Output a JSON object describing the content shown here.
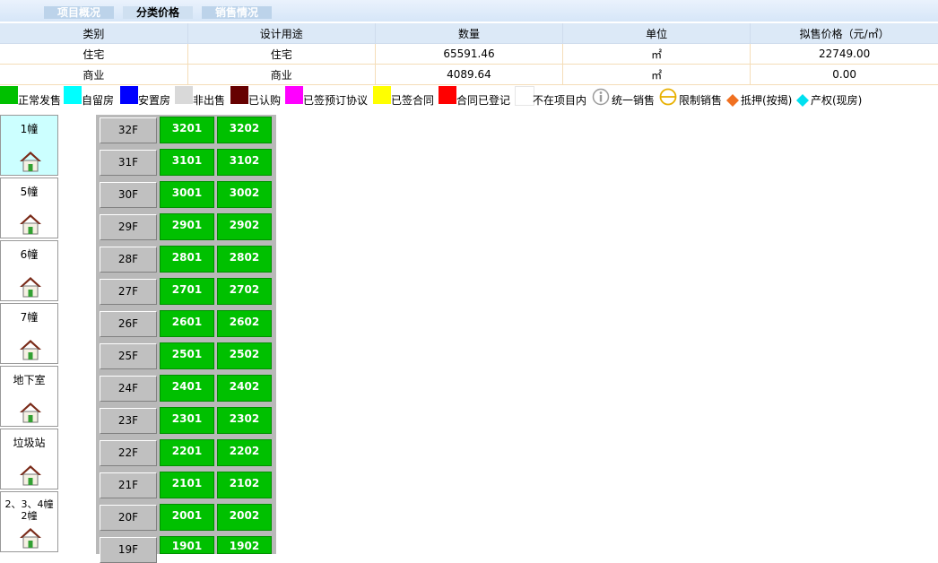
{
  "tabs": [
    "项目概况",
    "分类价格",
    "销售情况"
  ],
  "summary": {
    "headers": [
      "类别",
      "设计用途",
      "数量",
      "单位",
      "拟售价格（元/㎡）"
    ],
    "rows": [
      [
        "住宅",
        "住宅",
        "65591.46",
        "㎡",
        "22749.00"
      ],
      [
        "商业",
        "商业",
        "4089.64",
        "㎡",
        "0.00"
      ]
    ]
  },
  "legend": {
    "items": [
      {
        "label": "正常发售",
        "color": "#00c000"
      },
      {
        "label": "自留房",
        "color": "#00ffff"
      },
      {
        "label": "安置房",
        "color": "#0000ff"
      },
      {
        "label": "非出售",
        "color": "#d9d9d9"
      },
      {
        "label": "已认购",
        "color": "#660000"
      },
      {
        "label": "已签预订协议",
        "color": "#ff00ff"
      },
      {
        "label": "已签合同",
        "color": "#ffff00"
      },
      {
        "label": "合同已登记",
        "color": "#ff0000"
      },
      {
        "label": "不在项目内",
        "color": "#ffffff"
      }
    ],
    "symbols": [
      {
        "label": "统一销售",
        "icon": "info-circle-icon"
      },
      {
        "label": "限制销售",
        "icon": "limit-circle-icon"
      },
      {
        "label": "抵押(按揭)",
        "icon": "orange-diamond-icon",
        "color": "#f07020"
      },
      {
        "label": "产权(现房)",
        "icon": "cyan-diamond-icon",
        "color": "#00e0f0"
      }
    ]
  },
  "buildings": [
    {
      "name": "1幢",
      "active": true
    },
    {
      "name": "5幢",
      "active": false
    },
    {
      "name": "6幢",
      "active": false
    },
    {
      "name": "7幢",
      "active": false
    },
    {
      "name": "地下室",
      "active": false
    },
    {
      "name": "垃圾站",
      "active": false
    },
    {
      "name": "2、3、4幢2幢",
      "active": false
    }
  ],
  "floors": [
    {
      "floor": "32F",
      "rooms": [
        "3201",
        "3202"
      ]
    },
    {
      "floor": "31F",
      "rooms": [
        "3101",
        "3102"
      ]
    },
    {
      "floor": "30F",
      "rooms": [
        "3001",
        "3002"
      ]
    },
    {
      "floor": "29F",
      "rooms": [
        "2901",
        "2902"
      ]
    },
    {
      "floor": "28F",
      "rooms": [
        "2801",
        "2802"
      ]
    },
    {
      "floor": "27F",
      "rooms": [
        "2701",
        "2702"
      ]
    },
    {
      "floor": "26F",
      "rooms": [
        "2601",
        "2602"
      ]
    },
    {
      "floor": "25F",
      "rooms": [
        "2501",
        "2502"
      ]
    },
    {
      "floor": "24F",
      "rooms": [
        "2401",
        "2402"
      ]
    },
    {
      "floor": "23F",
      "rooms": [
        "2301",
        "2302"
      ]
    },
    {
      "floor": "22F",
      "rooms": [
        "2201",
        "2202"
      ]
    },
    {
      "floor": "21F",
      "rooms": [
        "2101",
        "2102"
      ]
    },
    {
      "floor": "20F",
      "rooms": [
        "2001",
        "2002"
      ]
    },
    {
      "floor": "19F",
      "rooms": [
        "1901",
        "1902"
      ]
    }
  ]
}
